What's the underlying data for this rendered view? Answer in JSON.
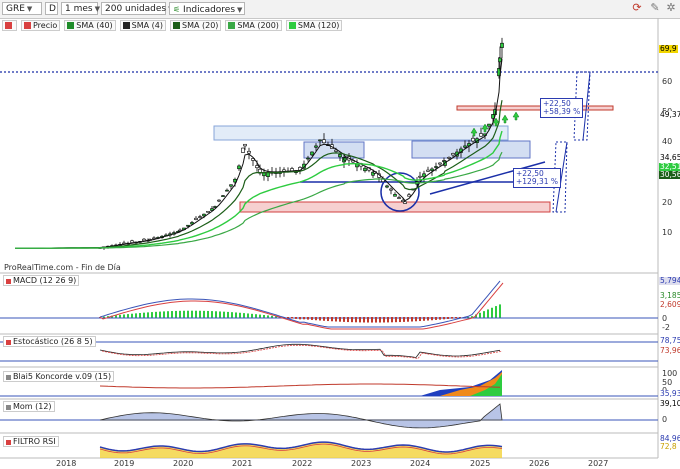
{
  "toolbar": {
    "symbol": "GRE",
    "mode": "D",
    "period": "1 mes",
    "units": "200 unidades",
    "indicators_label": "Indicadores"
  },
  "legend": [
    {
      "label": "Precio",
      "color": "#d94040"
    },
    {
      "label": "SMA (40)",
      "color": "#1f8c2a"
    },
    {
      "label": "SMA (4)",
      "color": "#222222"
    },
    {
      "label": "SMA (20)",
      "color": "#1c5e18"
    },
    {
      "label": "SMA (200)",
      "color": "#39a845"
    },
    {
      "label": "SMA (120)",
      "color": "#2ecc40"
    }
  ],
  "watermark": "ProRealTime.com - Fin de Día",
  "price_axis": {
    "ticks": [
      "60",
      "50",
      "40",
      "30",
      "20",
      "10"
    ],
    "tags": [
      {
        "text": "69,9",
        "color": "#f2d600",
        "fg": "#000"
      },
      {
        "text": "49,37",
        "color": "#ffffff",
        "fg": "#000"
      },
      {
        "text": "34,65",
        "color": "#ffffff",
        "fg": "#000"
      },
      {
        "text": "32,51",
        "color": "#2ecc40",
        "fg": "#fff"
      },
      {
        "text": "30,56",
        "color": "#1c5e18",
        "fg": "#fff"
      }
    ]
  },
  "annotations": {
    "upper_a": "+22,50",
    "upper_b": "+58,39 %",
    "lower_a": "+22,50",
    "lower_b": "+129,31 %"
  },
  "years": [
    "2018",
    "2019",
    "2020",
    "2021",
    "2022",
    "2023",
    "2024",
    "2025",
    "2026",
    "2027"
  ],
  "panels": {
    "macd": {
      "label": "MACD (12 26 9)",
      "tags": [
        "5,794",
        "3,185",
        "2,609"
      ],
      "ticks": [
        "0",
        "-2"
      ]
    },
    "stoch": {
      "label": "Estocástico (26 8 5)",
      "tags": [
        "78,75",
        "73,96"
      ]
    },
    "blai": {
      "label": "Blai5 Koncorde v.09 (15)",
      "ticks": [
        "100",
        "50",
        "0"
      ],
      "tags": [
        "35,93"
      ]
    },
    "mom": {
      "label": "Mom (12)",
      "tags": [
        "39,10"
      ],
      "ticks": [
        "0"
      ]
    },
    "rsi": {
      "label": "FILTRO RSI",
      "tags": [
        "84,96",
        "72,8"
      ]
    }
  }
}
